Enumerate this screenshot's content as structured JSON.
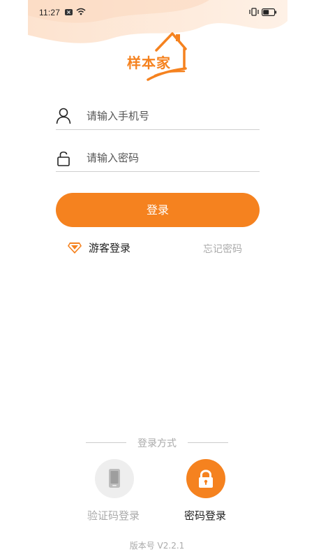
{
  "colors": {
    "accent": "#f5821f",
    "muted": "#aaaaaa",
    "text": "#222222"
  },
  "status_bar": {
    "time": "11:27",
    "icons": [
      "notification-x-icon",
      "wifi-icon",
      "vibrate-icon",
      "battery-icon"
    ]
  },
  "logo": {
    "text": "样本家"
  },
  "login_form": {
    "phone": {
      "placeholder": "请输入手机号",
      "value": "",
      "icon": "user-icon"
    },
    "password": {
      "placeholder": "请输入密码",
      "value": "",
      "icon": "lock-icon"
    },
    "submit_label": "登录"
  },
  "guest": {
    "label": "游客登录",
    "icon": "diamond-icon"
  },
  "forgot_password": "忘记密码",
  "login_methods": {
    "title": "登录方式",
    "options": [
      {
        "label": "验证码登录",
        "icon": "phone-icon",
        "active": false
      },
      {
        "label": "密码登录",
        "icon": "padlock-icon",
        "active": true
      }
    ]
  },
  "version": "版本号 V2.2.1"
}
